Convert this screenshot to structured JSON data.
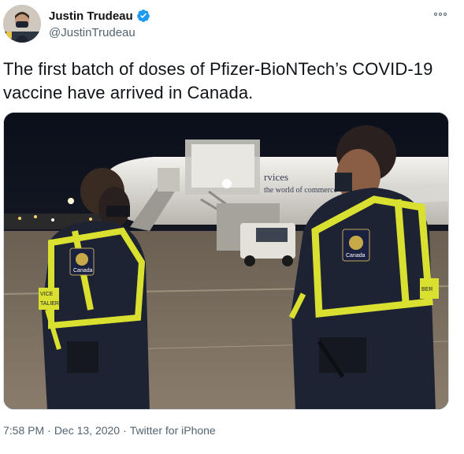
{
  "user": {
    "display_name": "Justin Trudeau",
    "handle": "@JustinTrudeau",
    "verified": true,
    "avatar_icon": "avatar-photo-icon"
  },
  "tweet": {
    "text": "The first batch of doses of Pfizer-BioNTech’s COVID-19 vaccine have arrived in Canada.",
    "media": {
      "aircraft_text_1": "rvices",
      "aircraft_text_2": "the world of commerce",
      "badge_text": "Canada",
      "vest_text_1": "VICE",
      "vest_text_2": "TALIER",
      "vest_text_3": "BER"
    }
  },
  "meta": {
    "time": "7:58 PM",
    "separator": "·",
    "date": "Dec 13, 2020",
    "source": "Twitter for iPhone"
  },
  "colors": {
    "verified": "#1d9bf0",
    "text": "#0f1419",
    "secondary": "#536471",
    "vest_yellow": "#d9e030",
    "uniform_navy": "#1d2333"
  }
}
